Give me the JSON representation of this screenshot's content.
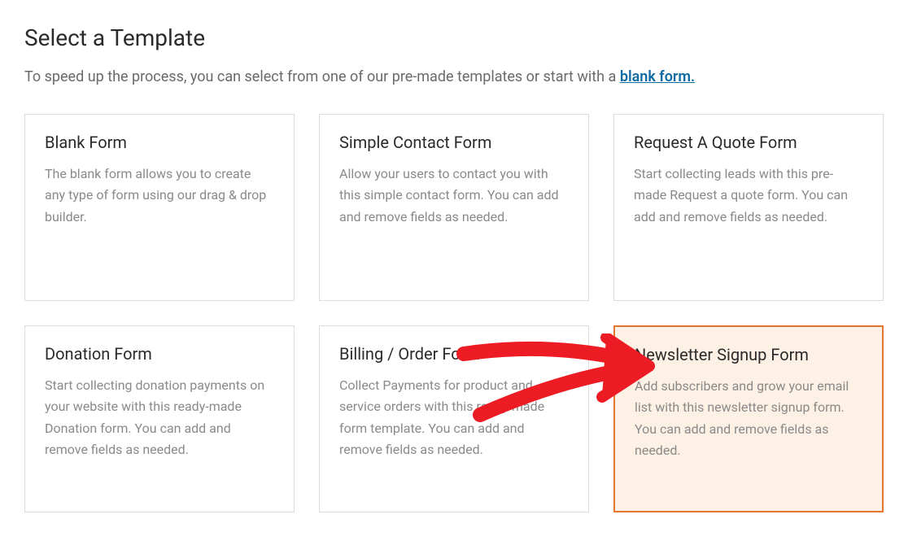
{
  "header": {
    "title": "Select a Template",
    "subtitle_prefix": "To speed up the process, you can select from one of our pre-made templates or start with a ",
    "blank_link_label": "blank form."
  },
  "templates": [
    {
      "title": "Blank Form",
      "desc": "The blank form allows you to create any type of form using our drag & drop builder.",
      "highlighted": false
    },
    {
      "title": "Simple Contact Form",
      "desc": "Allow your users to contact you with this simple contact form. You can add and remove fields as needed.",
      "highlighted": false
    },
    {
      "title": "Request A Quote Form",
      "desc": "Start collecting leads with this pre-made Request a quote form. You can add and remove fields as needed.",
      "highlighted": false
    },
    {
      "title": "Donation Form",
      "desc": "Start collecting donation payments on your website with this ready-made Donation form. You can add and remove fields as needed.",
      "highlighted": false
    },
    {
      "title": "Billing / Order Form",
      "desc": "Collect Payments for product and service orders with this ready-made form template. You can add and remove fields as needed.",
      "highlighted": false
    },
    {
      "title": "Newsletter Signup Form",
      "desc": "Add subscribers and grow your email list with this newsletter signup form. You can add and remove fields as needed.",
      "highlighted": true
    }
  ]
}
